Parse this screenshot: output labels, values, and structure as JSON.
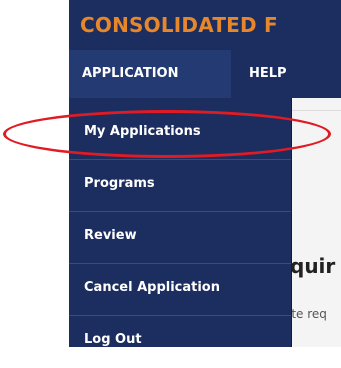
{
  "header": {
    "title": "CONSOLIDATED F"
  },
  "menubar": {
    "tabs": [
      {
        "label": "APPLICATION"
      },
      {
        "label": "HELP"
      }
    ]
  },
  "dropdown": {
    "items": [
      {
        "label": "My Applications"
      },
      {
        "label": "Programs"
      },
      {
        "label": "Review"
      },
      {
        "label": "Cancel Application"
      },
      {
        "label": "Log Out"
      }
    ]
  },
  "content": {
    "heading": "quir",
    "subtext": "ite req"
  },
  "colors": {
    "header_bg": "#1c2e5f",
    "title_text": "#e8862a",
    "highlight": "#e01b24"
  }
}
